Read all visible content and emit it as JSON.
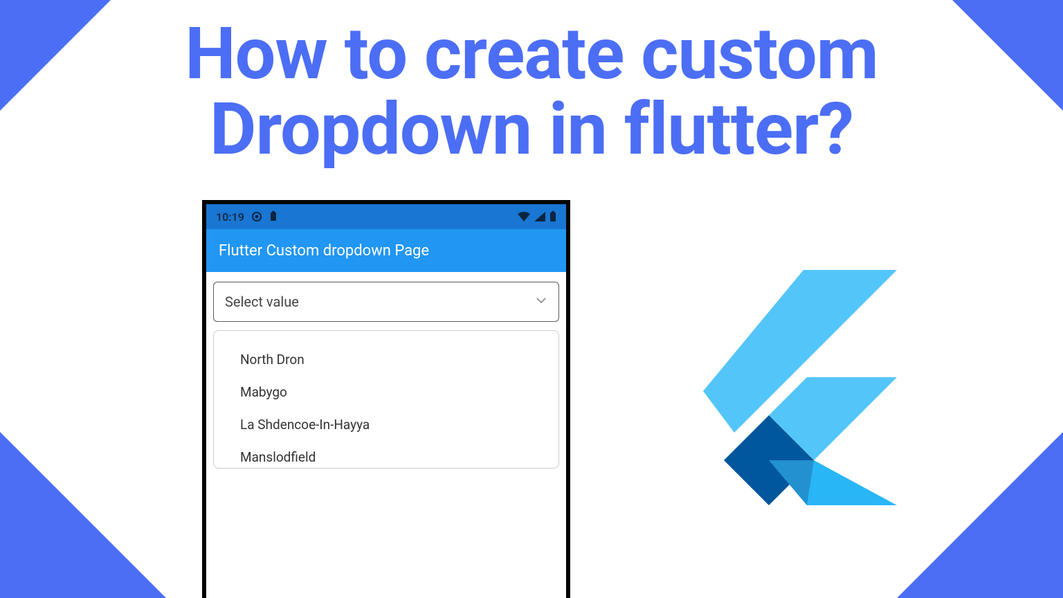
{
  "title_line1": "How to create custom",
  "title_line2": "Dropdown in flutter?",
  "phone": {
    "status": {
      "time": "10:19",
      "icons_left": [
        "rec-icon",
        "battery-icon-small"
      ],
      "icons_right": [
        "wifi-icon",
        "signal-icon",
        "battery-icon"
      ]
    },
    "appbar_title": "Flutter Custom dropdown Page",
    "dropdown": {
      "placeholder": "Select value",
      "options": [
        "North Dron",
        "Mabygo",
        "La Shdencoe-In-Hayya",
        "Manslodfield"
      ]
    }
  },
  "logo_name": "flutter-logo",
  "colors": {
    "accent": "#4c6ef5",
    "appbar": "#2196f3",
    "statusbar": "#1976d2"
  }
}
